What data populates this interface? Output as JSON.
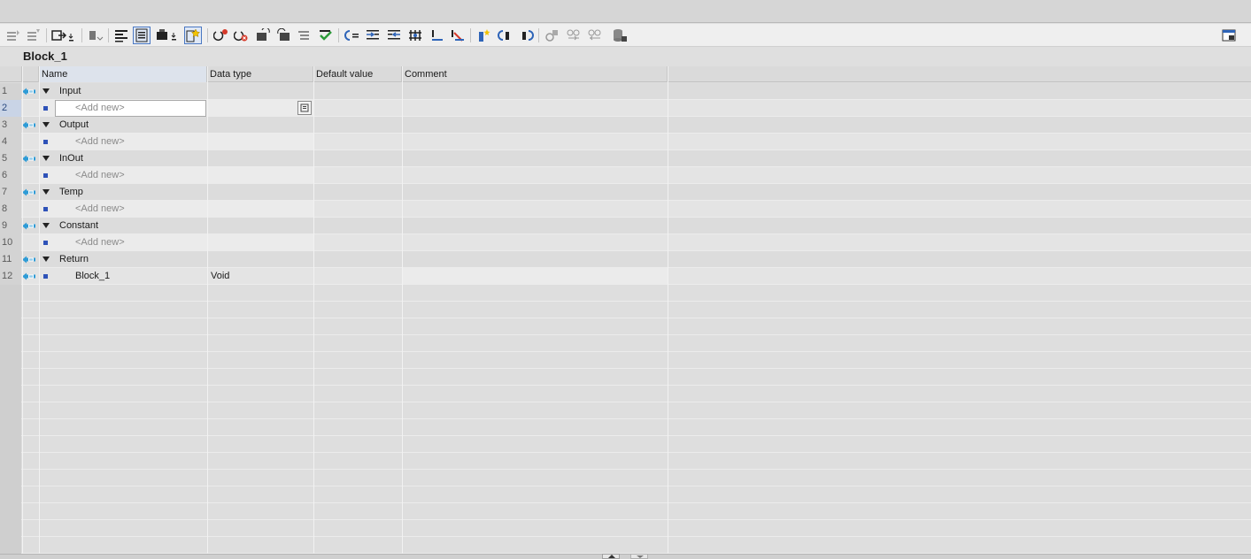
{
  "block": {
    "title": "Block_1"
  },
  "columns": {
    "name": "Name",
    "data_type": "Data type",
    "default_value": "Default value",
    "comment": "Comment"
  },
  "rows": [
    {
      "num": "1",
      "kind": "group",
      "name": "Input"
    },
    {
      "num": "2",
      "kind": "item",
      "name": "<Add new>",
      "placeholder": true,
      "selected": true
    },
    {
      "num": "3",
      "kind": "group",
      "name": "Output"
    },
    {
      "num": "4",
      "kind": "item",
      "name": "<Add new>",
      "placeholder": true
    },
    {
      "num": "5",
      "kind": "group",
      "name": "InOut"
    },
    {
      "num": "6",
      "kind": "item",
      "name": "<Add new>",
      "placeholder": true
    },
    {
      "num": "7",
      "kind": "group",
      "name": "Temp"
    },
    {
      "num": "8",
      "kind": "item",
      "name": "<Add new>",
      "placeholder": true
    },
    {
      "num": "9",
      "kind": "group",
      "name": "Constant"
    },
    {
      "num": "10",
      "kind": "item",
      "name": "<Add new>",
      "placeholder": true
    },
    {
      "num": "11",
      "kind": "group",
      "name": "Return"
    },
    {
      "num": "12",
      "kind": "return",
      "name": "Block_1",
      "data_type": "Void"
    }
  ],
  "toolbar_icons": [
    "insert-row-icon",
    "add-row-icon",
    "open-block-call-icon",
    "go-to-icon",
    "list-view-icon",
    "interface-view-icon",
    "display-mode-icon",
    "favorites-icon",
    "insert-network-icon",
    "delete-network-icon",
    "expand-networks-icon",
    "collapse-networks-icon",
    "comment-icon",
    "compile-icon",
    "indent-left-icon",
    "indent-right-icon",
    "align-icon",
    "bit-icon",
    "split-icon",
    "connect-icon",
    "highlight-icon",
    "jump-prev-icon",
    "jump-next-icon",
    "monitor-icon",
    "watch-on-icon",
    "watch-off-icon",
    "database-icon",
    "window-layout-icon"
  ],
  "colors": {
    "accent": "#2e9bd6",
    "item_marker": "#2e52b8",
    "selection": "#4a78c2"
  }
}
